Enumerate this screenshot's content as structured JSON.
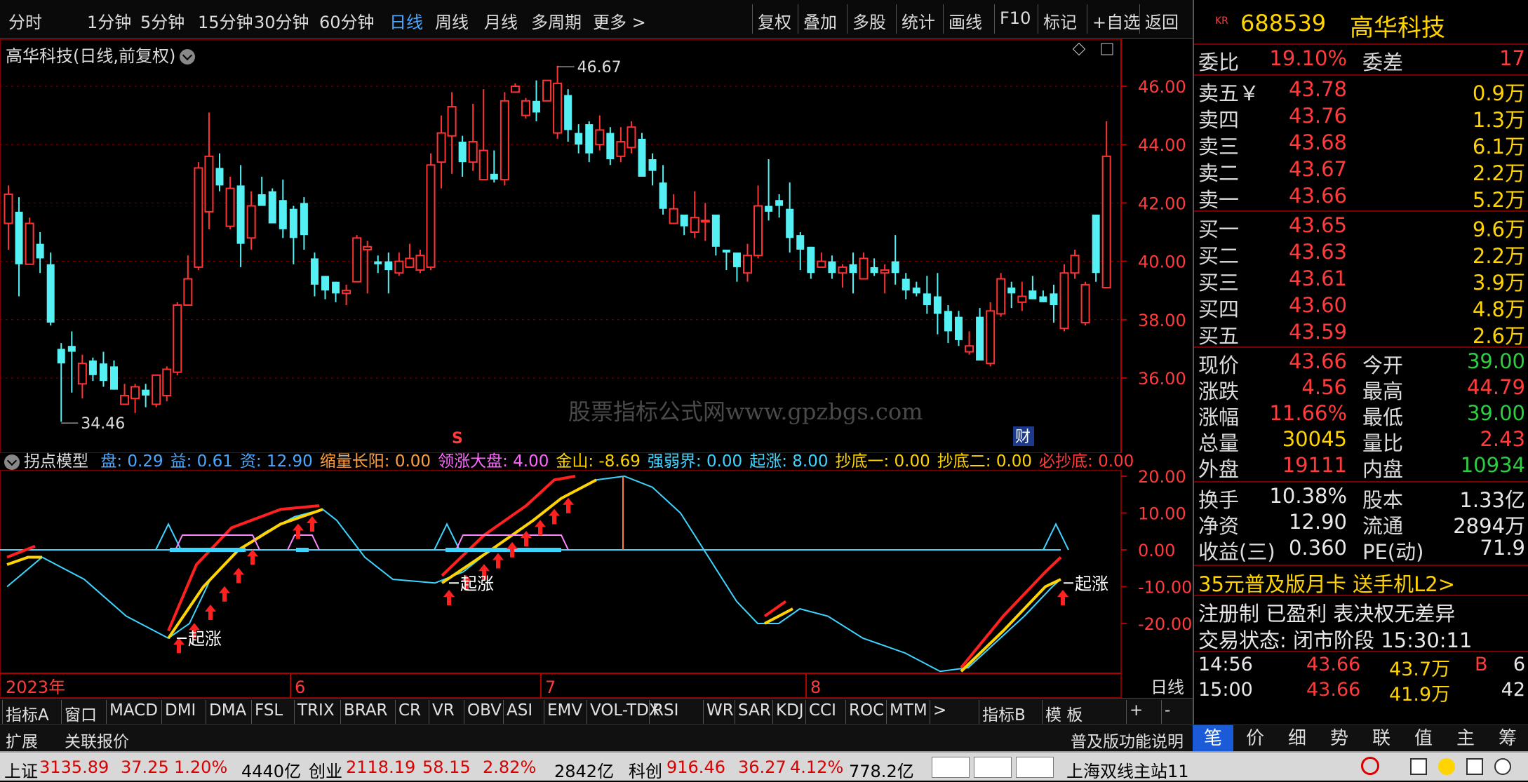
{
  "toolbar": {
    "periods": [
      "分时",
      "1分钟",
      "5分钟",
      "15分钟",
      "30分钟",
      "60分钟",
      "日线",
      "周线",
      "月线",
      "多周期",
      "更多 >"
    ],
    "active_period": "日线",
    "actions": [
      "复权",
      "叠加",
      "多股",
      "统计",
      "画线",
      "F10",
      "标记",
      "+自选",
      "返回"
    ]
  },
  "chart": {
    "title": "高华科技(日线,前复权)",
    "price_ticks": [
      "46.00",
      "44.00",
      "42.00",
      "40.00",
      "38.00",
      "36.00"
    ],
    "high_label": "46.67",
    "low_label": "34.46",
    "marker_s": "S",
    "marker_cai": "财",
    "watermark": "股票指标公式网www.gpzbgs.com",
    "candles": [
      [
        41.3,
        42.3,
        40.4,
        42.6
      ],
      [
        41.7,
        39.9,
        38.8,
        42.2
      ],
      [
        39.9,
        41.3,
        39.9,
        41.5
      ],
      [
        40.6,
        40.1,
        39.6,
        41.0
      ],
      [
        39.9,
        37.9,
        37.8,
        40.3
      ],
      [
        37.0,
        36.5,
        34.5,
        37.2
      ],
      [
        37.1,
        36.9,
        35.5,
        37.6
      ],
      [
        35.8,
        36.5,
        35.3,
        36.8
      ],
      [
        36.6,
        36.1,
        35.9,
        36.7
      ],
      [
        36.5,
        35.9,
        35.7,
        36.9
      ],
      [
        36.4,
        35.6,
        35.6,
        36.6
      ],
      [
        35.1,
        35.4,
        35.1,
        35.8
      ],
      [
        35.3,
        35.7,
        34.8,
        35.8
      ],
      [
        35.6,
        35.4,
        35.0,
        35.8
      ],
      [
        35.1,
        36.1,
        35.0,
        36.1
      ],
      [
        35.4,
        36.3,
        35.2,
        36.4
      ],
      [
        36.2,
        38.5,
        36.1,
        38.6
      ],
      [
        38.5,
        39.4,
        38.5,
        40.2
      ],
      [
        39.8,
        43.2,
        39.7,
        43.4
      ],
      [
        41.7,
        43.6,
        41.1,
        45.1
      ],
      [
        43.2,
        42.6,
        42.4,
        43.7
      ],
      [
        41.2,
        42.5,
        41.1,
        42.9
      ],
      [
        42.6,
        40.6,
        39.8,
        43.3
      ],
      [
        40.8,
        41.9,
        40.4,
        42.4
      ],
      [
        42.3,
        41.9,
        41.9,
        42.9
      ],
      [
        42.4,
        41.3,
        41.3,
        42.5
      ],
      [
        42.1,
        41.1,
        40.8,
        42.8
      ],
      [
        41.8,
        40.8,
        39.9,
        41.9
      ],
      [
        42.0,
        40.9,
        40.4,
        42.2
      ],
      [
        40.1,
        39.2,
        38.8,
        40.3
      ],
      [
        39.5,
        39.0,
        38.7,
        39.5
      ],
      [
        39.3,
        38.9,
        38.6,
        39.3
      ],
      [
        38.9,
        39.0,
        38.5,
        39.2
      ],
      [
        39.3,
        40.8,
        39.4,
        40.9
      ],
      [
        40.4,
        40.5,
        38.9,
        40.7
      ],
      [
        40.0,
        39.9,
        39.6,
        40.2
      ],
      [
        40.0,
        39.7,
        38.9,
        40.3
      ],
      [
        39.6,
        40.0,
        39.5,
        40.3
      ],
      [
        39.8,
        40.1,
        39.8,
        40.6
      ],
      [
        39.7,
        40.2,
        39.6,
        40.4
      ],
      [
        39.8,
        43.3,
        39.7,
        43.7
      ],
      [
        43.4,
        44.4,
        42.5,
        45.0
      ],
      [
        44.3,
        45.3,
        43.0,
        45.8
      ],
      [
        44.1,
        43.4,
        42.9,
        44.3
      ],
      [
        43.4,
        44.1,
        43.1,
        45.4
      ],
      [
        42.8,
        43.8,
        43.1,
        45.9
      ],
      [
        43.0,
        42.8,
        42.7,
        43.8
      ],
      [
        42.8,
        45.5,
        42.6,
        45.8
      ],
      [
        45.8,
        46.0,
        45.8,
        46.1
      ],
      [
        45.0,
        45.5,
        44.9,
        45.6
      ],
      [
        45.5,
        45.1,
        44.8,
        46.2
      ],
      [
        45.5,
        46.2,
        45.6,
        46.2
      ],
      [
        44.4,
        46.1,
        44.2,
        46.7
      ],
      [
        45.7,
        44.5,
        44.1,
        45.9
      ],
      [
        44.4,
        44.0,
        43.7,
        44.7
      ],
      [
        44.7,
        43.7,
        43.4,
        44.8
      ],
      [
        44.0,
        44.5,
        43.8,
        45.0
      ],
      [
        44.4,
        43.5,
        43.3,
        44.6
      ],
      [
        43.6,
        44.1,
        43.4,
        44.6
      ],
      [
        43.9,
        44.6,
        43.7,
        44.8
      ],
      [
        44.2,
        42.9,
        42.9,
        44.4
      ],
      [
        43.5,
        43.1,
        42.6,
        43.7
      ],
      [
        42.7,
        41.8,
        41.6,
        43.3
      ],
      [
        41.3,
        41.8,
        41.3,
        42.3
      ],
      [
        41.6,
        41.2,
        40.9,
        41.5
      ],
      [
        41.0,
        41.5,
        40.8,
        42.4
      ],
      [
        41.4,
        41.4,
        40.7,
        42.0
      ],
      [
        41.6,
        40.5,
        40.2,
        41.6
      ],
      [
        40.4,
        40.3,
        39.7,
        40.4
      ],
      [
        40.3,
        39.8,
        39.3,
        40.2
      ],
      [
        39.6,
        40.2,
        39.3,
        40.6
      ],
      [
        40.2,
        41.9,
        40.1,
        42.6
      ],
      [
        41.9,
        41.7,
        41.4,
        43.5
      ],
      [
        42.1,
        41.9,
        41.5,
        42.3
      ],
      [
        41.8,
        40.8,
        40.3,
        42.7
      ],
      [
        40.9,
        40.4,
        39.7,
        41.0
      ],
      [
        40.5,
        39.6,
        39.4,
        40.5
      ],
      [
        39.8,
        40.0,
        39.8,
        40.3
      ],
      [
        40.0,
        39.6,
        39.4,
        40.2
      ],
      [
        39.6,
        39.8,
        39.1,
        39.9
      ],
      [
        39.9,
        39.6,
        38.9,
        40.3
      ],
      [
        39.4,
        40.1,
        39.6,
        40.3
      ],
      [
        39.8,
        39.6,
        39.5,
        40.1
      ],
      [
        39.6,
        39.7,
        38.9,
        39.9
      ],
      [
        40.0,
        39.6,
        39.2,
        40.9
      ],
      [
        39.4,
        39.0,
        38.7,
        39.6
      ],
      [
        39.1,
        38.9,
        38.8,
        39.3
      ],
      [
        38.9,
        38.5,
        38.2,
        39.5
      ],
      [
        38.8,
        38.2,
        37.5,
        39.6
      ],
      [
        38.3,
        37.6,
        37.2,
        38.5
      ],
      [
        38.1,
        37.3,
        37.1,
        38.3
      ],
      [
        36.9,
        37.1,
        36.8,
        37.6
      ],
      [
        38.1,
        36.6,
        36.6,
        38.4
      ],
      [
        36.5,
        38.3,
        36.4,
        38.6
      ],
      [
        38.2,
        39.4,
        38.1,
        39.6
      ],
      [
        39.1,
        38.9,
        38.4,
        39.3
      ],
      [
        38.6,
        38.8,
        38.3,
        39.3
      ],
      [
        39.0,
        38.7,
        38.7,
        39.5
      ],
      [
        38.8,
        38.6,
        38.6,
        39.0
      ],
      [
        38.9,
        38.5,
        37.9,
        39.2
      ],
      [
        37.7,
        39.6,
        37.6,
        39.9
      ],
      [
        39.6,
        40.2,
        39.4,
        40.4
      ],
      [
        37.9,
        39.2,
        37.8,
        39.3
      ],
      [
        41.6,
        39.6,
        39.3,
        41.6
      ],
      [
        39.1,
        43.6,
        39.1,
        44.8
      ]
    ]
  },
  "indicator": {
    "name": "拐点模型",
    "params": [
      {
        "label": "盘: 0.29",
        "color": "#4aa8ff"
      },
      {
        "label": "益: 0.61",
        "color": "#4aa8ff"
      },
      {
        "label": "资: 12.90",
        "color": "#4aa8ff"
      },
      {
        "label": "缩量长阳: 0.00",
        "color": "#ffa040"
      },
      {
        "label": "领涨大盘: 4.00",
        "color": "#ff66ff"
      },
      {
        "label": "金山: -8.69",
        "color": "#ffd400"
      },
      {
        "label": "强弱界: 0.00",
        "color": "#3dd5ff"
      },
      {
        "label": "起涨: 8.00",
        "color": "#3dd5ff"
      },
      {
        "label": "抄底一: 0.00",
        "color": "#ffd400"
      },
      {
        "label": "抄底二: 0.00",
        "color": "#ffd400"
      },
      {
        "label": "必抄底: 0.00",
        "color": "#ff3b3b"
      }
    ],
    "ticks": [
      "20.00",
      "10.00",
      "0.00",
      "-10.00",
      "-20.00"
    ],
    "qizhang_labels": [
      "起涨",
      "起涨",
      "起涨"
    ]
  },
  "time_axis": {
    "year": "2023年",
    "months": [
      "6",
      "7",
      "8"
    ],
    "period": "日线"
  },
  "indicator_tabs": [
    "指标A",
    "窗口",
    "MACD",
    "DMI",
    "DMA",
    "FSL",
    "TRIX",
    "BRAR",
    "CR",
    "VR",
    "OBV",
    "ASI",
    "EMV",
    "VOL-TDX",
    "RSI",
    "WR",
    "SAR",
    "KDJ",
    "CCI",
    "ROC",
    "MTM",
    ">",
    "指标B",
    "模 板",
    "+",
    "-"
  ],
  "ext_bar": {
    "expand": "扩展",
    "related": "关联报价",
    "promo": "普及版功能说明"
  },
  "stock": {
    "badge": "KR",
    "code": "688539",
    "name": "高华科技",
    "weibi_label": "委比",
    "weibi": "19.10%",
    "weicha_label": "委差",
    "weicha": "17",
    "asks": [
      {
        "label": "卖五￥",
        "price": "43.78",
        "vol": "0.9万"
      },
      {
        "label": "卖四",
        "price": "43.76",
        "vol": "1.3万"
      },
      {
        "label": "卖三",
        "price": "43.68",
        "vol": "6.1万"
      },
      {
        "label": "卖二",
        "price": "43.67",
        "vol": "2.2万"
      },
      {
        "label": "卖一",
        "price": "43.66",
        "vol": "5.2万"
      }
    ],
    "bids": [
      {
        "label": "买一",
        "price": "43.65",
        "vol": "9.6万"
      },
      {
        "label": "买二",
        "price": "43.63",
        "vol": "2.2万"
      },
      {
        "label": "买三",
        "price": "43.61",
        "vol": "3.9万"
      },
      {
        "label": "买四",
        "price": "43.60",
        "vol": "4.8万"
      },
      {
        "label": "买五",
        "price": "43.59",
        "vol": "2.6万"
      }
    ],
    "quote": [
      {
        "k": "现价",
        "v": "43.66",
        "vc": "red",
        "k2": "今开",
        "v2": "39.00",
        "v2c": "green"
      },
      {
        "k": "涨跌",
        "v": "4.56",
        "vc": "red",
        "k2": "最高",
        "v2": "44.79",
        "v2c": "red"
      },
      {
        "k": "涨幅",
        "v": "11.66%",
        "vc": "red",
        "k2": "最低",
        "v2": "39.00",
        "v2c": "green"
      },
      {
        "k": "总量",
        "v": "30045",
        "vc": "yellow",
        "k2": "量比",
        "v2": "2.43",
        "v2c": "red"
      },
      {
        "k": "外盘",
        "v": "19111",
        "vc": "red",
        "k2": "内盘",
        "v2": "10934",
        "v2c": "green"
      }
    ],
    "fundamentals": [
      {
        "k": "换手",
        "v": "10.38%",
        "k2": "股本",
        "v2": "1.33亿"
      },
      {
        "k": "净资",
        "v": "12.90",
        "k2": "流通",
        "v2": "2894万"
      },
      {
        "k": "收益(三)",
        "v": "0.360",
        "k2": "PE(动)",
        "v2": "71.9"
      }
    ],
    "promo": "35元普及版月卡 送手机L2>",
    "promo2": "注册制 已盈利 表决权无差异",
    "trade_status": "交易状态: 闭市阶段 15:30:11",
    "ticks": [
      {
        "time": "14:56",
        "price": "43.66",
        "vol": "43.7万",
        "flag": "B",
        "n": "6"
      },
      {
        "time": "15:00",
        "price": "43.66",
        "vol": "41.9万",
        "flag": "",
        "n": "42"
      }
    ],
    "tabs": [
      "笔",
      "价",
      "细",
      "势",
      "联",
      "值",
      "主",
      "筹"
    ]
  },
  "statusbar": {
    "items": [
      {
        "t": "上证",
        "c": "#000"
      },
      {
        "t": "3135.89",
        "c": "#d00"
      },
      {
        "t": "37.25",
        "c": "#d00"
      },
      {
        "t": "1.20%",
        "c": "#d00"
      },
      {
        "t": "4440亿",
        "c": "#000"
      },
      {
        "t": "创业",
        "c": "#000"
      },
      {
        "t": "2118.19",
        "c": "#d00"
      },
      {
        "t": "58.15",
        "c": "#d00"
      },
      {
        "t": "2.82%",
        "c": "#d00"
      },
      {
        "t": "2842亿",
        "c": "#000"
      },
      {
        "t": "科创",
        "c": "#000"
      },
      {
        "t": "916.46",
        "c": "#d00"
      },
      {
        "t": "36.27",
        "c": "#d00"
      },
      {
        "t": "4.12%",
        "c": "#d00"
      },
      {
        "t": "778.2亿",
        "c": "#000"
      }
    ],
    "server": "上海双线主站11"
  }
}
